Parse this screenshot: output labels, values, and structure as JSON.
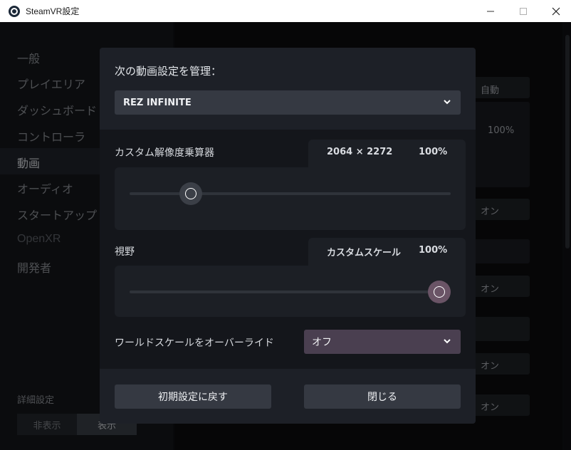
{
  "window": {
    "title": "SteamVR設定"
  },
  "sidebar": {
    "items": [
      {
        "label": "一般"
      },
      {
        "label": "プレイエリア"
      },
      {
        "label": "ダッシュボード"
      },
      {
        "label": "コントローラ"
      },
      {
        "label": "動画"
      },
      {
        "label": "オーディオ"
      },
      {
        "label": "スタートアップ"
      },
      {
        "label": "OpenXR"
      },
      {
        "label": "開発者"
      }
    ],
    "advanced_label": "詳細設定",
    "advanced_hide": "非表示",
    "advanced_show": "表示"
  },
  "background": {
    "auto_label": "自動",
    "percent": "100%",
    "on_label": "オン"
  },
  "dialog": {
    "title": "次の動画設定を管理：",
    "app_select_value": "REZ INFINITE",
    "resolution": {
      "label": "カスタム解像度乗算器",
      "resolution_text": "2064 × 2272",
      "percent": "100%",
      "slider_fraction": 0.19
    },
    "fov": {
      "label": "視野",
      "mode": "カスタムスケール",
      "percent": "100%",
      "slider_fraction": 1.0
    },
    "world_scale": {
      "label": "ワールドスケールをオーバーライド",
      "value": "オフ"
    },
    "reset_button": "初期設定に戻す",
    "close_button": "閉じる"
  },
  "colors": {
    "accent_off": "#4a3f50",
    "knob_fov": "#6a5466",
    "knob_res": "#3b3f47"
  }
}
